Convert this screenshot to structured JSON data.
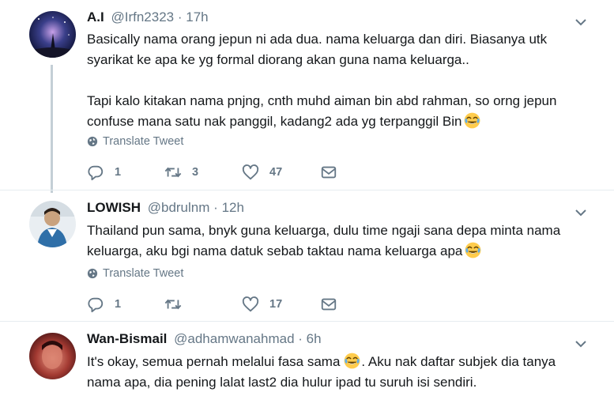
{
  "tweets": [
    {
      "name": "A.I",
      "handle": "@Irfn2323",
      "separator": "·",
      "time": "17h",
      "lines": [
        "Basically nama orang jepun ni ada dua. nama keluarga dan diri. Biasanya utk",
        "syarikat ke apa ke yg formal diorang akan guna nama keluarga..",
        "Tapi kalo kitakan nama pnjng, cnth muhd aiman bin abd rahman, so orng jepun",
        "confuse mana satu nak panggil, kadang2 ada yg terpanggil Bin"
      ],
      "emoji": "face-with-tears-of-joy",
      "translate": "Translate Tweet",
      "replies": "1",
      "retweets": "3",
      "likes": "47"
    },
    {
      "name": "LOWISH",
      "handle": "@bdrulnm",
      "separator": "·",
      "time": "12h",
      "lines": [
        "Thailand pun sama, bnyk guna keluarga, dulu time ngaji sana depa minta nama",
        "keluarga, aku bgi  nama datuk sebab taktau nama keluarga apa"
      ],
      "emoji": "face-with-tears-of-joy",
      "translate": "Translate Tweet",
      "replies": "1",
      "retweets": "",
      "likes": "17"
    },
    {
      "name": "Wan-Bismail",
      "handle": "@adhamwanahmad",
      "separator": "·",
      "time": "6h",
      "line1_a": "It's okay, semua pernah melalui fasa sama",
      "line1_b": ". Aku nak daftar subjek dia tanya",
      "line2": "nama apa, dia pening lalat last2 dia hulur ipad tu suruh isi sendiri.",
      "emoji": "face-with-tears-of-joy"
    }
  ],
  "colors": {
    "text": "#14171a",
    "secondary": "#657786",
    "divider": "#e6ecf0",
    "thread_line": "#c4cfd6"
  }
}
